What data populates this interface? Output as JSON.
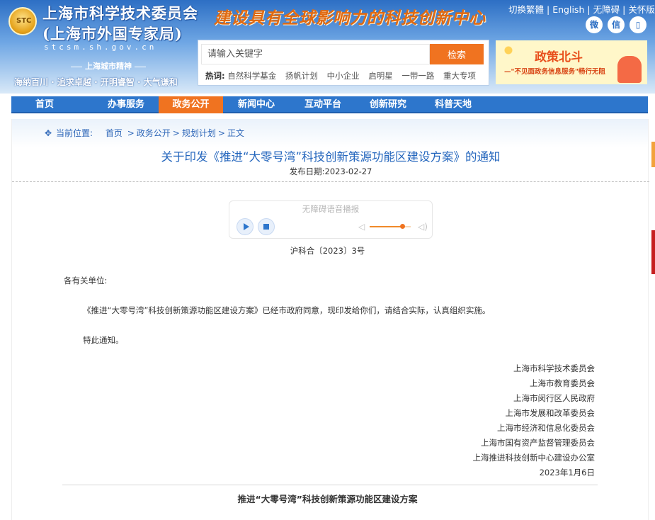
{
  "header": {
    "org_title": "上海市科学技术委员会",
    "org_subtitle": "(上海市外国专家局)",
    "domain": "stcsm.sh.gov.cn",
    "spirit_title": "上海城市精神",
    "spirit_text": "海纳百川 · 追求卓越 · 开明睿智 · 大气谦和",
    "slogan": "建设具有全球影响力的科技创新中心",
    "top_links": [
      "切换繁體",
      "English",
      "无障碍",
      "关怀版"
    ],
    "social_icons": [
      "weibo-icon",
      "wechat-icon",
      "mobile-icon"
    ]
  },
  "search": {
    "placeholder": "请输入关键字",
    "button_label": "检索",
    "hot_label": "热词:",
    "hot_words": [
      "自然科学基金",
      "扬帆计划",
      "中小企业",
      "启明星",
      "一带一路",
      "重大专项"
    ]
  },
  "policy_banner": {
    "title": "政策北斗",
    "subtitle": "—\"不见面政务信息服务\"畅行无阻"
  },
  "nav": {
    "items": [
      "首页",
      "办事服务",
      "政务公开",
      "新闻中心",
      "互动平台",
      "创新研究",
      "科普天地"
    ],
    "active": "政务公开"
  },
  "breadcrumb": {
    "label": "当前位置:",
    "items": [
      "首页",
      "政务公开",
      "规划计划",
      "正文"
    ]
  },
  "article": {
    "title": "关于印发《推进“大零号湾”科技创新策源功能区建设方案》的通知",
    "date_label": "发布日期:",
    "date": "2023-02-27",
    "doc_number": "沪科合〔2023〕3号",
    "salutation": "各有关单位:",
    "paragraph1": "《推进“大零号湾”科技创新策源功能区建设方案》已经市政府同意，现印发给你们，请结合实际，认真组织实施。",
    "paragraph2": "特此通知。",
    "signers": [
      "上海市科学技术委员会",
      "上海市教育委员会",
      "上海市闵行区人民政府",
      "上海市发展和改革委员会",
      "上海市经济和信息化委员会",
      "上海市国有资产监督管理委员会",
      "上海推进科技创新中心建设办公室"
    ],
    "sign_date": "2023年1月6日",
    "plan_title": "推进“大零号湾”科技创新策源功能区建设方案"
  },
  "tts": {
    "title": "无障碍语音播报",
    "volume_level": 0.8
  },
  "colors": {
    "nav_blue": "#2d76cc",
    "accent_orange": "#f07320",
    "title_blue": "#2466bd"
  }
}
